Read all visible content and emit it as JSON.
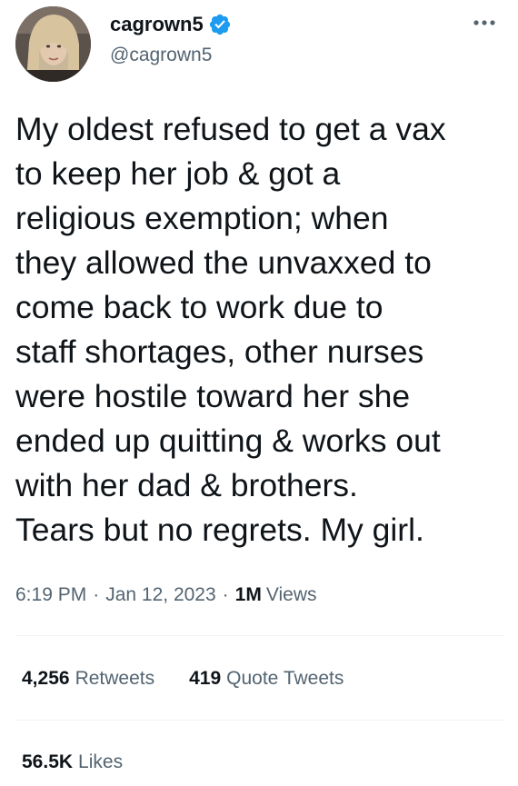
{
  "author": {
    "display_name": "cagrown5",
    "handle": "@cagrown5",
    "verified": true,
    "avatar_icon": "avatar-photo",
    "verified_icon": "verified-badge-icon",
    "verified_color": "#1d9bf0"
  },
  "menu": {
    "more_icon": "more-options-icon"
  },
  "tweet": {
    "text": "My oldest refused to get a vax\nto keep her job & got a\nreligious exemption; when\nthey allowed the unvaxxed to\ncome back to work due to\nstaff shortages, other nurses\nwere hostile toward her she\nended up quitting & works out\nwith her dad & brothers.\nTears but no regrets. My girl."
  },
  "meta": {
    "time": "6:19 PM",
    "date": "Jan 12, 2023",
    "separator": "·",
    "views_count": "1M",
    "views_label": "Views"
  },
  "stats": {
    "retweets_count": "4,256",
    "retweets_label": "Retweets",
    "quote_tweets_count": "419",
    "quote_tweets_label": "Quote Tweets",
    "likes_count": "56.5K",
    "likes_label": "Likes"
  },
  "colors": {
    "text_primary": "#0f1419",
    "text_secondary": "#536471",
    "divider": "#eff3f4"
  }
}
